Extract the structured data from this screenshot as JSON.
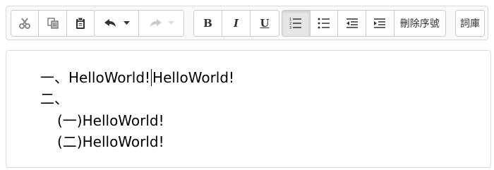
{
  "toolbar": {
    "cut_icon": "scissors-icon",
    "copy_icon": "copy-icon",
    "paste_icon": "clipboard-icon",
    "undo_icon": "undo-arrow-icon",
    "redo_icon": "redo-arrow-icon",
    "bold_label": "B",
    "italic_label": "I",
    "underline_label": "U",
    "ordered_list_icon": "ordered-list-icon",
    "unordered_list_icon": "unordered-list-icon",
    "outdent_icon": "outdent-icon",
    "indent_icon": "indent-icon",
    "remove_numbering_label": "刪除序號",
    "glossary_label": "詞庫"
  },
  "editor": {
    "lines": [
      {
        "marker": "一、",
        "text_before_caret": "HelloWorld!",
        "text_after_caret": "HelloWorld!"
      },
      {
        "marker": "二、",
        "text": ""
      },
      {
        "marker": "(一)",
        "text": "HelloWorld!"
      },
      {
        "marker": "(二)",
        "text": "HelloWorld!"
      }
    ]
  }
}
